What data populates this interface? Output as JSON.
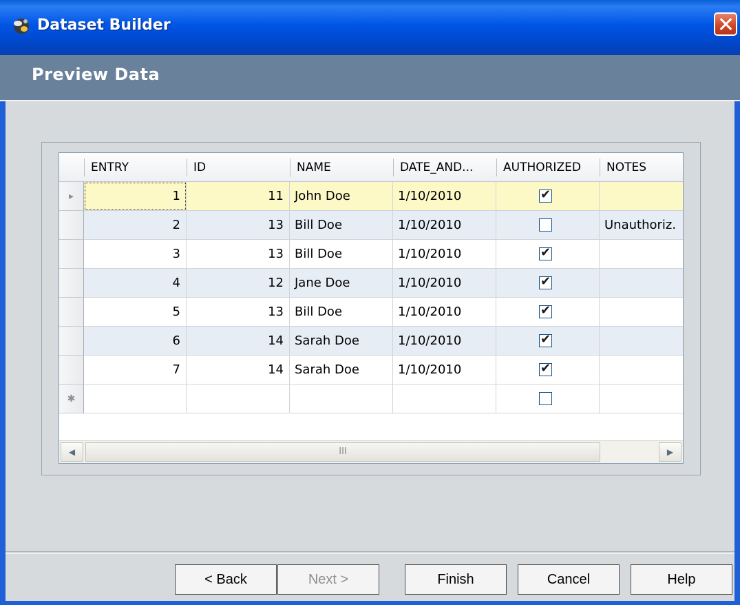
{
  "window": {
    "title": "Dataset Builder"
  },
  "header": {
    "page_title": "Preview Data"
  },
  "grid": {
    "columns": [
      "ENTRY",
      "ID",
      "NAME",
      "DATE_AND...",
      "AUTHORIZED",
      "NOTES"
    ],
    "rows": [
      {
        "entry": "1",
        "id": "11",
        "name": "John Doe",
        "date": "1/10/2010",
        "authorized": true,
        "notes": ""
      },
      {
        "entry": "2",
        "id": "13",
        "name": "Bill Doe",
        "date": "1/10/2010",
        "authorized": false,
        "notes": "Unauthoriz."
      },
      {
        "entry": "3",
        "id": "13",
        "name": "Bill Doe",
        "date": "1/10/2010",
        "authorized": true,
        "notes": ""
      },
      {
        "entry": "4",
        "id": "12",
        "name": "Jane Doe",
        "date": "1/10/2010",
        "authorized": true,
        "notes": ""
      },
      {
        "entry": "5",
        "id": "13",
        "name": "Bill Doe",
        "date": "1/10/2010",
        "authorized": true,
        "notes": ""
      },
      {
        "entry": "6",
        "id": "14",
        "name": "Sarah Doe",
        "date": "1/10/2010",
        "authorized": true,
        "notes": ""
      },
      {
        "entry": "7",
        "id": "14",
        "name": "Sarah Doe",
        "date": "1/10/2010",
        "authorized": true,
        "notes": ""
      }
    ],
    "selected_row_color": "#fdf9c7",
    "alt_row_color": "#e7edf5",
    "current_row_glyph": "▸",
    "new_row_glyph": "✱",
    "scroll_grip": "III"
  },
  "buttons": {
    "back": "< Back",
    "next": "Next >",
    "finish": "Finish",
    "cancel": "Cancel",
    "help": "Help"
  }
}
